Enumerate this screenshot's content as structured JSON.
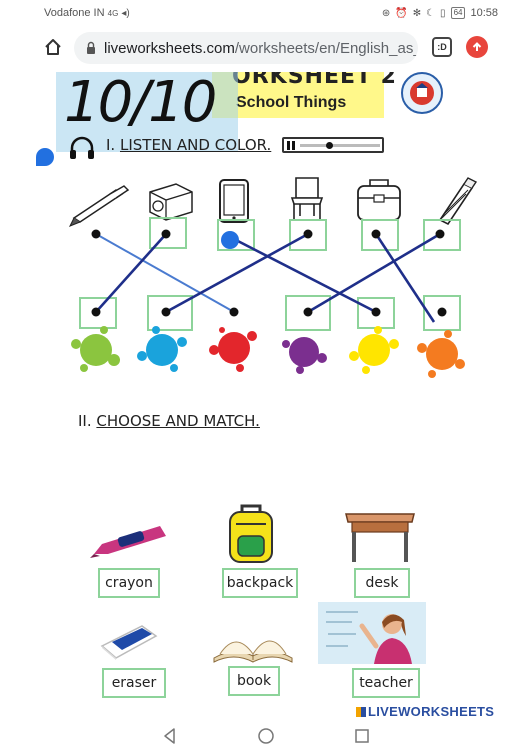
{
  "status_bar": {
    "carrier": "Vodafone IN",
    "signal": "4G",
    "battery": "64",
    "time": "10:58"
  },
  "browser": {
    "url_domain": "liveworksheets.com",
    "url_path": "/worksheets/en/English_as_",
    "tabs_label": ":D",
    "icons": [
      "home-icon",
      "lock-icon",
      "tabs-icon",
      "update-icon"
    ]
  },
  "worksheet": {
    "score": "10/10",
    "title": "ORKSHEET 2",
    "subtitle": "School Things",
    "section1": {
      "number": "I.",
      "heading": "LISTEN AND COLOR."
    },
    "section2": {
      "number": "II.",
      "heading": "CHOOSE AND MATCH."
    },
    "objects": [
      "pen",
      "pencil-sharpener",
      "tablet",
      "chair",
      "school-bag",
      "crayon"
    ],
    "paint_colors": [
      "#8bc53f",
      "#1aa3dc",
      "#e3262c",
      "#7b2f8f",
      "#ffe500",
      "#f47b20"
    ],
    "words": {
      "crayon": "crayon",
      "backpack": "backpack",
      "desk": "desk",
      "eraser": "eraser",
      "book": "book",
      "teacher": "teacher"
    },
    "brand": "LIVEWORKSHEETS"
  },
  "nav": {
    "icons": [
      "back-icon",
      "home-circle-icon",
      "recents-icon"
    ]
  },
  "colors": {
    "match_line": "#1f2f8a",
    "match_line_light": "#4a7bd0",
    "box_border": "#8dd39a",
    "title_bg": "#fff88a",
    "score_bg": "#a0d2eb",
    "accent_blue": "#2270e0"
  }
}
